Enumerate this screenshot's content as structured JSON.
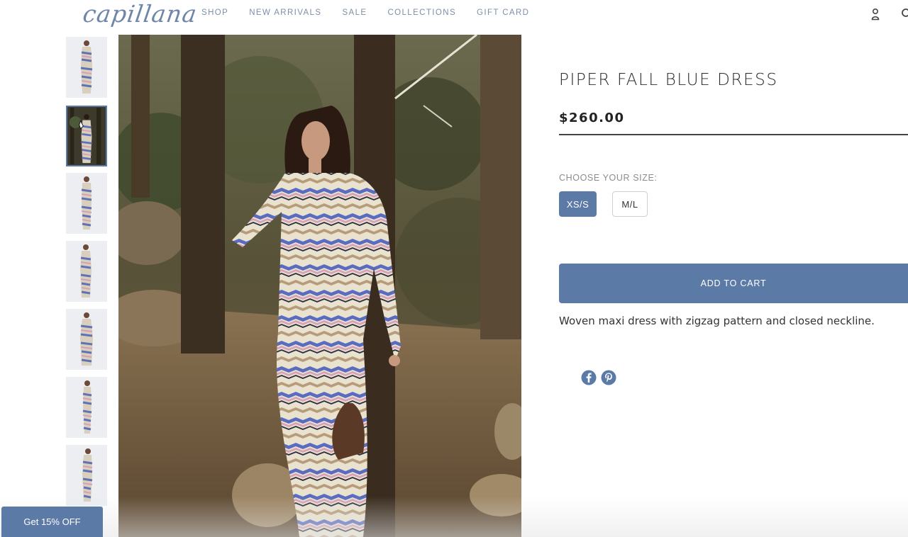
{
  "header": {
    "logo": "capillana",
    "nav": [
      "SHOP",
      "NEW ARRIVALS",
      "SALE",
      "COLLECTIONS",
      "GIFT CARD"
    ],
    "account_icon": "user-icon",
    "search_icon": "search-icon"
  },
  "gallery": {
    "thumbnail_count": 7,
    "active_index": 1
  },
  "product": {
    "title": "PIPER FALL BLUE DRESS",
    "price": "$260.00",
    "size_label": "CHOOSE YOUR SIZE:",
    "sizes": [
      "XS/S",
      "M/L"
    ],
    "selected_size": "XS/S",
    "add_to_cart": "ADD TO CART",
    "description": "Woven maxi dress with zigzag pattern and closed neckline.",
    "share_icons": [
      "facebook-icon",
      "pinterest-icon"
    ]
  },
  "promo": {
    "label": "Get 15% OFF"
  },
  "colors": {
    "accent": "#5b7ba6",
    "nav_text": "#7d8ea6",
    "logo": "#6f86a8"
  }
}
